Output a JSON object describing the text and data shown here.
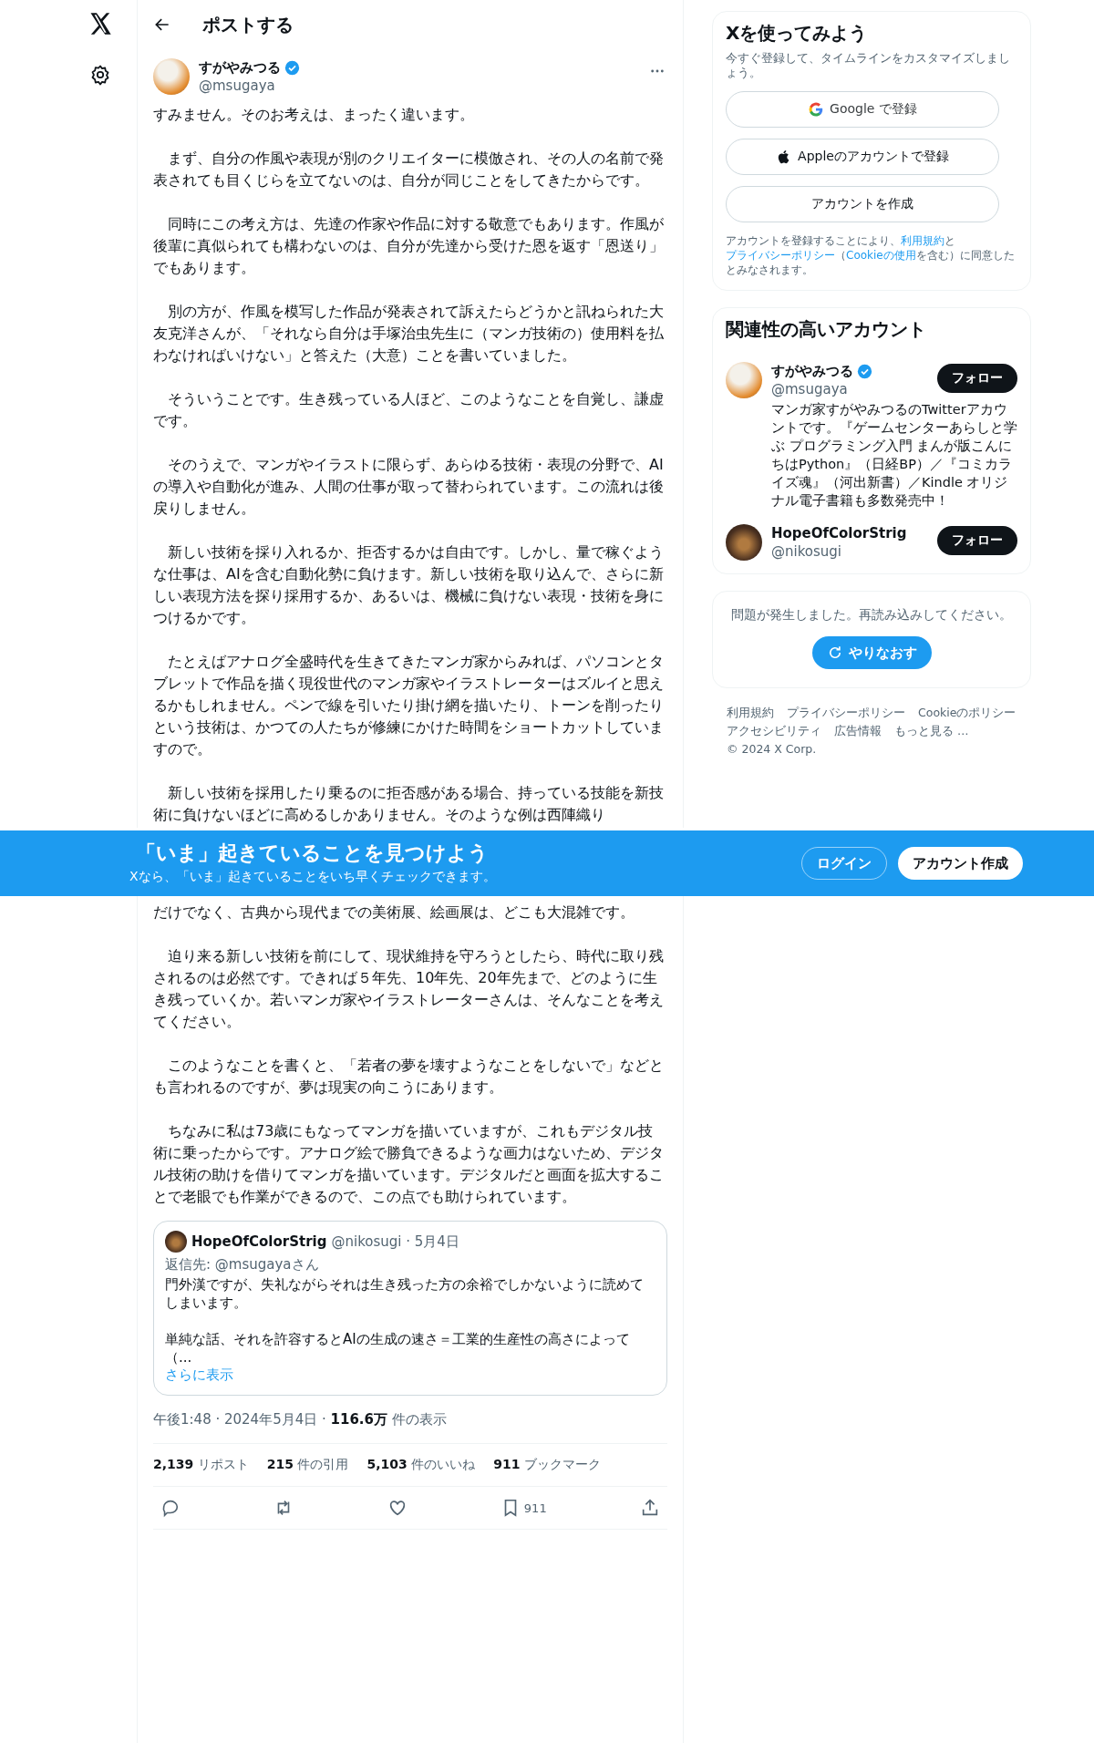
{
  "header": {
    "title": "ポストする"
  },
  "post": {
    "author": {
      "name": "すがやみつる",
      "verified": true,
      "handle": "@msugaya"
    },
    "paragraphs_before": [
      "すみません。そのお考えは、まったく違います。",
      "　まず、自分の作風や表現が別のクリエイターに模倣され、その人の名前で発表されても目くじらを立てないのは、自分が同じことをしてきたからです。",
      "　同時にこの考え方は、先達の作家や作品に対する敬意でもあります。作風が後輩に真似られても構わないのは、自分が先達から受けた恩を返す「恩送り」でもあります。",
      "　別の方が、作風を模写した作品が発表されて訴えたらどうかと訊ねられた大友克洋さんが、「それなら自分は手塚治虫先生に（マンガ技術の）使用料を払わなければいけない」と答えた（大意）ことを書いていました。",
      "　そういうことです。生き残っている人ほど、このようなことを自覚し、謙虚です。",
      "　そのうえで、マンガやイラストに限らず、あらゆる技術・表現の分野で、AIの導入や自動化が進み、人間の仕事が取って替わられています。この流れは後戻りしません。",
      "　新しい技術を採り入れるか、拒否するかは自由です。しかし、量で稼ぐような仕事は、AIを含む自動化勢に負けます。新しい技術を取り込んで、さらに新しい表現方法を探り採用するか、あるいは、機械に負けない表現・技術を身につけるかです。",
      "　たとえばアナログ全盛時代を生きてきたマンガ家からみれば、パソコンとタブレットで作品を描く現役世代のマンガ家やイラストレーターはズルイと思えるかもしれません。ペンで線を引いたり掛け網を描いたり、トーンを削ったりという技術は、かつての人たちが修練にかけた時間をショートカットしていますので。",
      "　新しい技術を採用したり乗るのに拒否感がある場合、持っている技能を新技術に負けないほどに高めるしかありません。そのような例は西陣織り"
    ],
    "paragraphs_after": [
      "だけでなく、古典から現代までの美術展、絵画展は、どこも大混雑です。",
      "　迫り来る新しい技術を前にして、現状維持を守ろうとしたら、時代に取り残されるのは必然です。できれば５年先、10年先、20年先まで、どのように生き残っていくか。若いマンガ家やイラストレーターさんは、そんなことを考えてください。",
      "　このようなことを書くと、「若者の夢を壊すようなことをしないで」などとも言われるのですが、夢は現実の向こうにあります。",
      "　ちなみに私は73歳にもなってマンガを描いていますが、これもデジタル技術に乗ったからです。アナログ絵で勝負できるような画力はないため、デジタル技術の助けを借りてマンガを描いています。デジタルだと画面を拡大することで老眼でも作業ができるので、この点でも助けられています。"
    ],
    "quote": {
      "name": "HopeOfColorStrig",
      "meta": "@nikosugi · 5月4日",
      "reply_to": "返信先: @msugayaさん",
      "paragraphs": [
        "門外漢ですが、失礼ながらそれは生き残った方の余裕でしかないように読めてしまいます。",
        "単純な話、それを許容するとAIの生成の速さ＝工業的生産性の高さによって（..."
      ],
      "show_more": "さらに表示"
    },
    "meta": "午後1:48 · 2024年5月4日 · **116.6万** 件の表示",
    "stats": [
      "**2,139** リポスト",
      "**215** 件の引用",
      "**5,103** 件のいいね",
      "**911** ブックマーク"
    ],
    "actions": [
      {
        "kind": "reply"
      },
      {
        "kind": "repost"
      },
      {
        "kind": "like"
      },
      {
        "kind": "bookmark",
        "count": "911"
      },
      {
        "kind": "share"
      }
    ]
  },
  "banner": {
    "title": "「いま」起きていることを見つけよう",
    "subtitle": "Xなら、「いま」起きていることをいち早くチェックできます。",
    "buttons": [
      {
        "kind": "outline",
        "label": "ログイン"
      },
      {
        "kind": "filled",
        "label": "アカウント作成"
      }
    ]
  },
  "signup": {
    "title": "Xを使ってみよう",
    "subtitle": "今すぐ登録して、タイムラインをカスタマイズしましょう。",
    "buttons": [
      {
        "kind": "google",
        "label": "Google で登録"
      },
      {
        "kind": "apple",
        "label": "Appleのアカウントで登録"
      },
      {
        "kind": "plain",
        "label": "アカウントを作成"
      }
    ],
    "legal": [
      {
        "text": "アカウントを登録することにより、",
        "link": false
      },
      {
        "text": "利用規約",
        "link": true
      },
      {
        "text": "と",
        "link": false
      },
      {
        "text": "プライバシーポリシー",
        "link": true
      },
      {
        "text": "（",
        "link": false
      },
      {
        "text": "Cookieの使用",
        "link": true
      },
      {
        "text": "を含む）に同意したとみなされます。",
        "link": false
      }
    ]
  },
  "related": {
    "title": "関連性の高いアカウント",
    "accounts": [
      {
        "name": "すがやみつる",
        "verified": true,
        "handle": "@msugaya",
        "button": "フォロー",
        "bio": "マンガ家すがやみつるのTwitterアカウントです。『ゲームセンターあらしと学ぶ プログラミング入門 まんが版こんにちはPython』（日経BP）／『コミカライズ魂』（河出新書）／Kindle オリジナル電子書籍も多数発売中！"
      },
      {
        "name": "HopeOfColorStrig",
        "verified": false,
        "handle": "@nikosugi",
        "button": "フォロー"
      }
    ]
  },
  "error_card": {
    "message": "問題が発生しました。再読み込みしてください。",
    "button": "やりなおす"
  },
  "footer": [
    "利用規約",
    "プライバシーポリシー",
    "Cookieのポリシー",
    "アクセシビリティ",
    "広告情報",
    "もっと見る …",
    "© 2024 X Corp."
  ]
}
